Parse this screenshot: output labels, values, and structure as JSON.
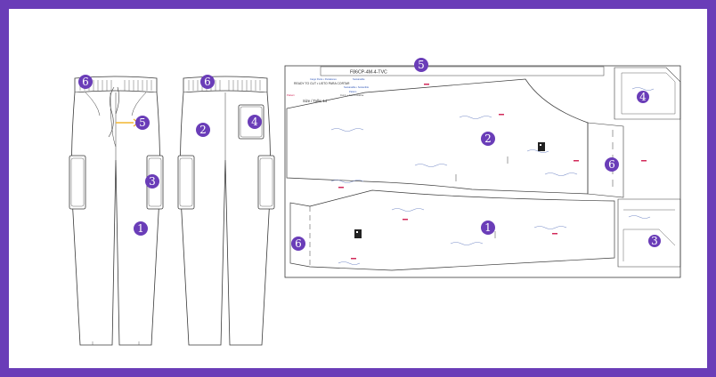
{
  "colors": {
    "frame": "#6a3db8",
    "marker": "#6a3db8",
    "arrow": "#f2b531",
    "line": "#3a3a3a",
    "pattern_blue": "#2f56b8",
    "pattern_red": "#d22a5a"
  },
  "markers": {
    "front_waistband": "6",
    "front_drawstring": "5",
    "front_cargo_pocket": "3",
    "front_leg": "1",
    "back_waistband": "6",
    "back_leg": "2",
    "back_pocket": "4",
    "sheet_top": "5",
    "sheet_back_piece": "2",
    "sheet_waistband_right": "6",
    "sheet_front_piece": "1",
    "sheet_waistband_left": "6",
    "sheet_top_right_piece": "4",
    "sheet_bottom_right_piece": "3"
  },
  "pattern_sheet": {
    "code": "F86CP-4M-4-TVC",
    "header_line_1": "Cargo Pants • Pantalones",
    "header_line_2": "READY TO CUT • LISTO PARA CORTAR",
    "size_label": "Size / Talla: 14",
    "logo": "Pattern",
    "blue_line_1": "Sustainable",
    "blue_line_2": "Sustainable • Sostenible",
    "blue_line_3": "Pattern",
    "blue_line_4": "Cut 1 + Cut 1 inverse"
  }
}
